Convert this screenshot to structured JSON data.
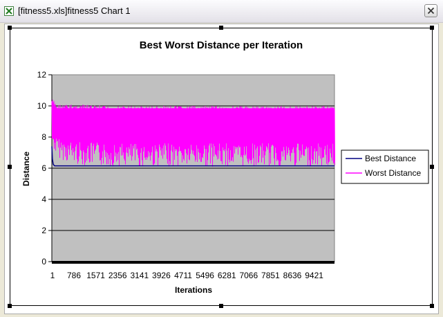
{
  "window": {
    "title": "[fitness5.xls]fitness5 Chart 1",
    "icon": "excel-icon",
    "close_icon": "close-icon"
  },
  "chart_data": {
    "type": "line",
    "title": "Best Worst Distance per Iteration",
    "xlabel": "Iterations",
    "ylabel": "Distance",
    "ylim": [
      0,
      12
    ],
    "yticks": [
      0,
      2,
      4,
      6,
      8,
      10,
      12
    ],
    "x_categories_first": 1,
    "x_categories_last": 10000,
    "x_tick_labels": [
      "1",
      "786",
      "1571",
      "2356",
      "3141",
      "3926",
      "4711",
      "5496",
      "6281",
      "7066",
      "7851",
      "8636",
      "9421"
    ],
    "grid": true,
    "plot_background": "#c0c0c0",
    "legend_position": "right",
    "series": [
      {
        "name": "Best Distance",
        "color": "#000080",
        "description_values": {
          "start": 7.4,
          "plateau": 6.15
        },
        "values_sampled_x": [
          1,
          20,
          50,
          100,
          200,
          500,
          1000,
          5000,
          10000
        ],
        "values": [
          7.4,
          6.6,
          6.25,
          6.15,
          6.15,
          6.15,
          6.15,
          6.15,
          6.15
        ]
      },
      {
        "name": "Worst Distance",
        "color": "#ff00ff",
        "values_sampled_x": [
          1,
          50,
          100,
          200,
          500,
          1000,
          2000,
          4000,
          6000,
          8000,
          10000
        ],
        "values_low": [
          9.0,
          8.2,
          7.8,
          7.6,
          7.3,
          7.1,
          7.0,
          7.0,
          7.0,
          7.0,
          7.0
        ],
        "values_high": [
          10.5,
          10.4,
          10.3,
          10.1,
          10.1,
          10.1,
          10.0,
          10.0,
          10.0,
          10.0,
          10.0
        ]
      }
    ]
  }
}
